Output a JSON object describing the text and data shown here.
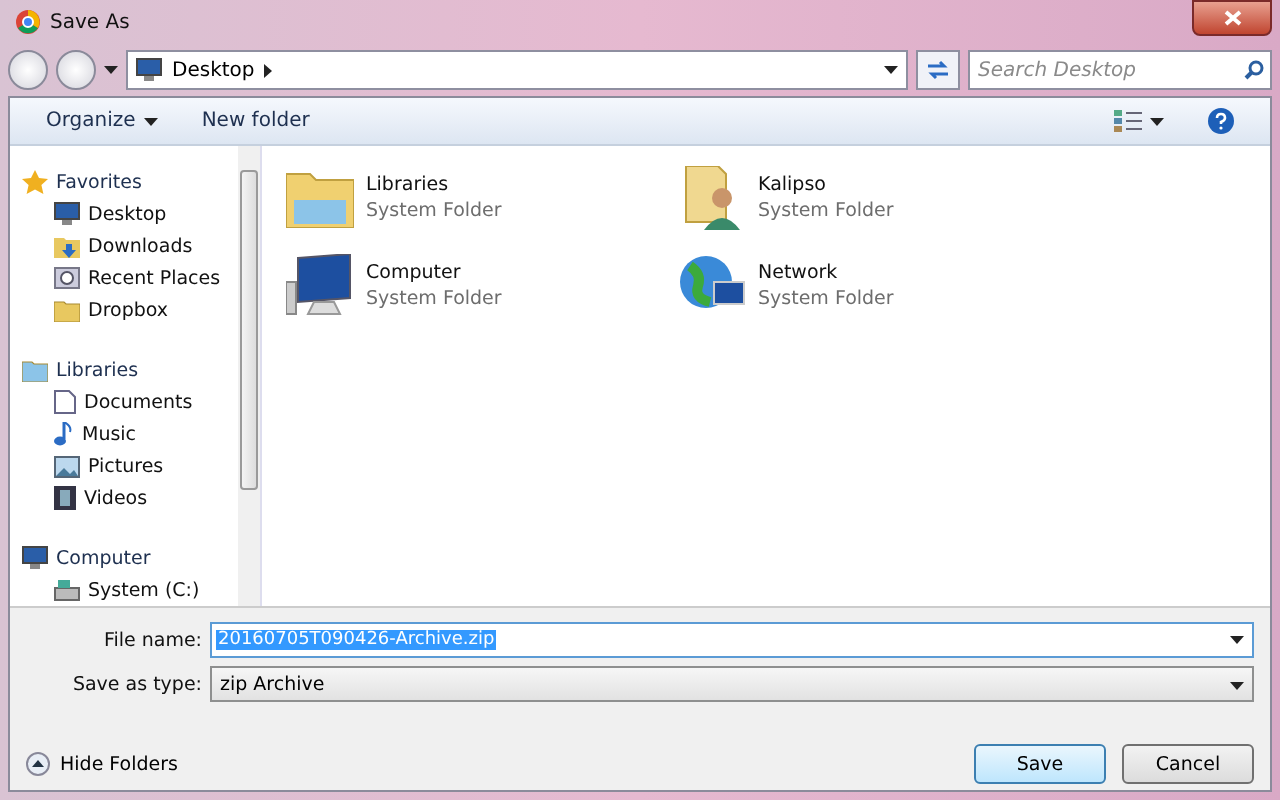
{
  "window": {
    "title": "Save As"
  },
  "address": {
    "location": "Desktop"
  },
  "search": {
    "placeholder": "Search Desktop"
  },
  "toolbar": {
    "organize": "Organize",
    "new_folder": "New folder"
  },
  "sidebar": {
    "groups": [
      {
        "label": "Favorites",
        "children": [
          {
            "label": "Desktop"
          },
          {
            "label": "Downloads"
          },
          {
            "label": "Recent Places"
          },
          {
            "label": "Dropbox"
          }
        ]
      },
      {
        "label": "Libraries",
        "children": [
          {
            "label": "Documents"
          },
          {
            "label": "Music"
          },
          {
            "label": "Pictures"
          },
          {
            "label": "Videos"
          }
        ]
      },
      {
        "label": "Computer",
        "children": [
          {
            "label": "System (C:)"
          }
        ]
      }
    ]
  },
  "items": [
    {
      "name": "Libraries",
      "type": "System Folder"
    },
    {
      "name": "Kalipso",
      "type": "System Folder"
    },
    {
      "name": "Computer",
      "type": "System Folder"
    },
    {
      "name": "Network",
      "type": "System Folder"
    }
  ],
  "form": {
    "file_name_label": "File name:",
    "file_name": "20160705T090426-Archive.zip",
    "type_label": "Save as type:",
    "type": "zip Archive"
  },
  "hide_folders": "Hide Folders",
  "buttons": [
    {
      "label": "Save",
      "default": true
    },
    {
      "label": "Cancel",
      "default": false
    }
  ]
}
